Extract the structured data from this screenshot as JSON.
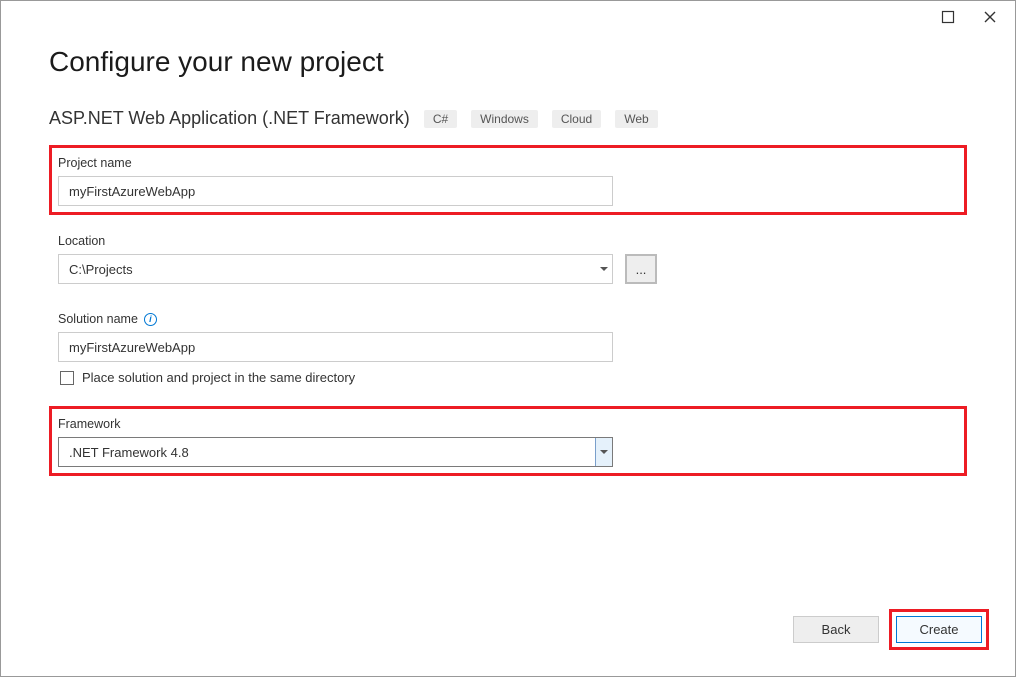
{
  "titlebar": {
    "maximize_name": "maximize",
    "close_name": "close"
  },
  "heading": "Configure your new project",
  "subtitle": "ASP.NET Web Application (.NET Framework)",
  "tags": [
    "C#",
    "Windows",
    "Cloud",
    "Web"
  ],
  "project_name": {
    "label": "Project name",
    "value": "myFirstAzureWebApp"
  },
  "location": {
    "label": "Location",
    "value": "C:\\Projects",
    "browse": "..."
  },
  "solution_name": {
    "label": "Solution name",
    "value": "myFirstAzureWebApp"
  },
  "checkbox": {
    "label": "Place solution and project in the same directory",
    "checked": false
  },
  "framework": {
    "label": "Framework",
    "value": ".NET Framework 4.8"
  },
  "footer": {
    "back": "Back",
    "create": "Create"
  }
}
